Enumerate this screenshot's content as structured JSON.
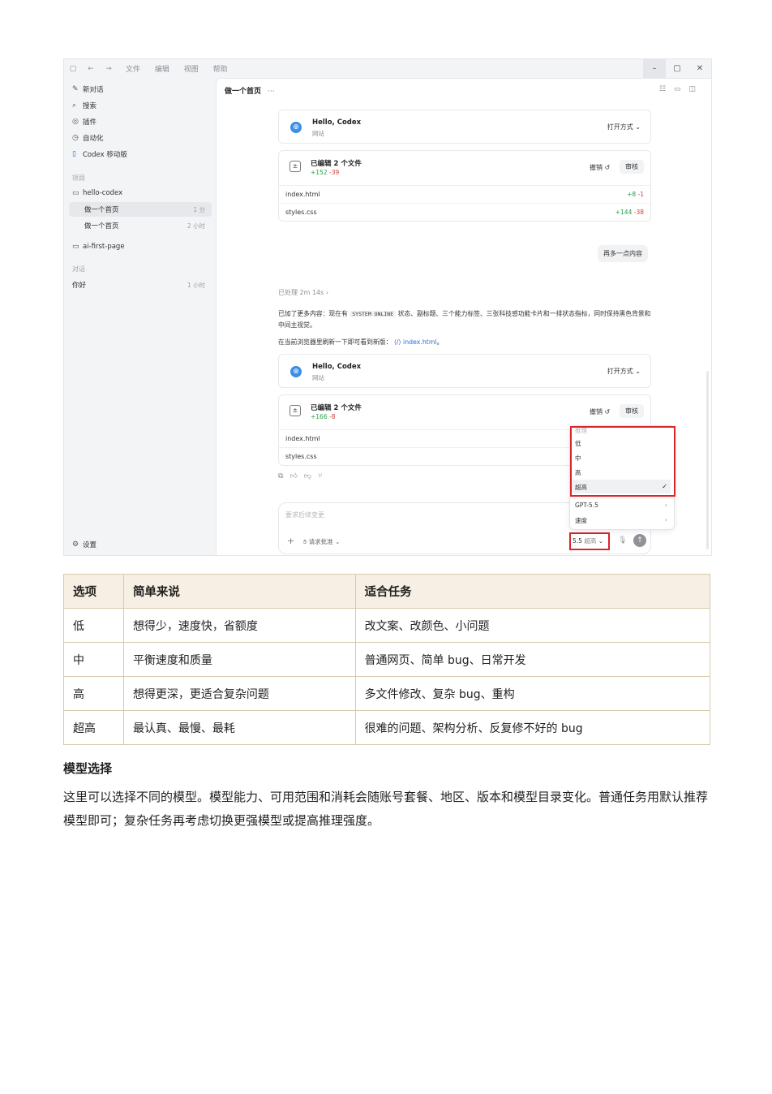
{
  "titlebar": {
    "menus": [
      "文件",
      "编辑",
      "视图",
      "帮助"
    ],
    "controls": [
      "–",
      "▢",
      "✕"
    ]
  },
  "sidebar": {
    "top_items": [
      {
        "icon": "edit-icon",
        "label": "新对话"
      },
      {
        "icon": "search-icon",
        "label": "搜索"
      },
      {
        "icon": "plugin-icon",
        "label": "插件"
      },
      {
        "icon": "clock-icon",
        "label": "自动化"
      },
      {
        "icon": "mobile-icon",
        "label": "Codex 移动版"
      }
    ],
    "projects_heading": "项目",
    "projects": [
      {
        "name": "hello-codex",
        "threads": [
          {
            "label": "做一个首页",
            "time": "1 分",
            "selected": true
          },
          {
            "label": "做一个首页",
            "time": "2 小时",
            "selected": false
          }
        ]
      },
      {
        "name": "ai-first-page",
        "threads": []
      }
    ],
    "chats_heading": "对话",
    "chats": [
      {
        "label": "你好",
        "time": "1 小时"
      }
    ],
    "settings_label": "设置"
  },
  "main": {
    "thread_title": "做一个首页",
    "thread_menu": "···",
    "site_card_1": {
      "title": "Hello, Codex",
      "sub": "网站",
      "open_label": "打开方式"
    },
    "edit_card_1": {
      "title": "已编辑 2 个文件",
      "add": "+152",
      "del": "-39",
      "undo_label": "撤销",
      "review_label": "审核",
      "files": [
        {
          "name": "index.html",
          "add": "+8",
          "del": "-1"
        },
        {
          "name": "styles.css",
          "add": "+144",
          "del": "-38"
        }
      ]
    },
    "user_chip": "再多一点内容",
    "processed": "已处理 2m 14s",
    "reply_para1_a": "已加了更多内容：现在有",
    "reply_code": "SYSTEM ONLINE",
    "reply_para1_b": "状态、副标题、三个能力标签、三张科技感功能卡片和一排状态指标，同时保持黑色背景和中间主视觉。",
    "reply_para2_a": "在当前浏览器里刷新一下即可看到新版：",
    "reply_link": "index.html",
    "reply_para2_b": "。",
    "site_card_2": {
      "title": "Hello, Codex",
      "sub": "网站",
      "open_label": "打开方式"
    },
    "edit_card_2": {
      "title": "已编辑 2 个文件",
      "add": "+166",
      "del": "-8",
      "undo_label": "撤销",
      "review_label": "审核",
      "files": [
        {
          "name": "index.html"
        },
        {
          "name": "styles.css"
        }
      ]
    },
    "composer": {
      "placeholder": "要求后续变更",
      "approval_label": "请求批准",
      "model_short": "5.5",
      "effort_short": "超高"
    },
    "dropdown": {
      "heading": "推理",
      "options": [
        "低",
        "中",
        "高",
        "超高"
      ],
      "selected": "超高",
      "model_label": "GPT-5.5",
      "speed_label": "速度"
    }
  },
  "table": {
    "headers": [
      "选项",
      "简单来说",
      "适合任务"
    ],
    "rows": [
      [
        "低",
        "想得少，速度快，省额度",
        "改文案、改颜色、小问题"
      ],
      [
        "中",
        "平衡速度和质量",
        "普通网页、简单 bug、日常开发"
      ],
      [
        "高",
        "想得更深，更适合复杂问题",
        "多文件修改、复杂 bug、重构"
      ],
      [
        "超高",
        "最认真、最慢、最耗",
        "很难的问题、架构分析、反复修不好的 bug"
      ]
    ]
  },
  "section_title": "模型选择",
  "section_body": "这里可以选择不同的模型。模型能力、可用范围和消耗会随账号套餐、地区、版本和模型目录变化。普通任务用默认推荐模型即可；复杂任务再考虑切换更强模型或提高推理强度。"
}
